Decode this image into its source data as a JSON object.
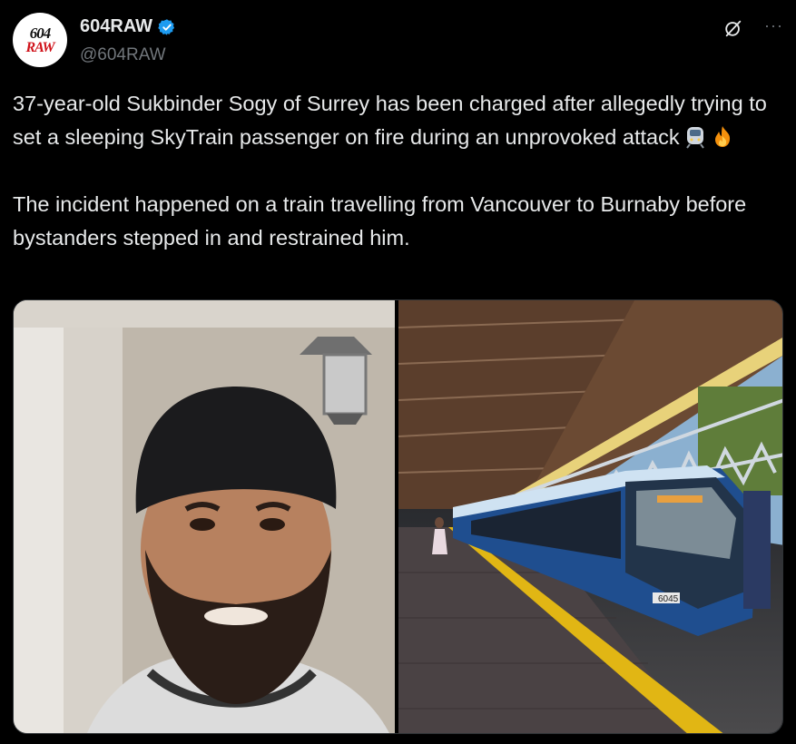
{
  "header": {
    "avatar": {
      "line1": "604",
      "line2": "RAW"
    },
    "display_name": "604RAW",
    "handle": "@604RAW",
    "verified": true,
    "icons": [
      "verified-badge-icon",
      "grok-icon",
      "more-icon"
    ],
    "more_label": "···"
  },
  "tweet": {
    "para1": "37-year-old Sukbinder Sogy of Surrey has been charged after allegedly trying to set a sleeping SkyTrain passenger on fire during an unprovoked attack",
    "para1_emojis": [
      "train-emoji",
      "fire-emoji"
    ],
    "para2": "The incident happened on a train travelling from Vancouver to Burnaby before bystanders stepped in and restrained him."
  },
  "media": {
    "photos": [
      {
        "subject": "man-portrait-photo"
      },
      {
        "subject": "skytrain-platform-photo",
        "train_number": "6045"
      }
    ]
  },
  "colors": {
    "background": "#000000",
    "text": "#e7e9ea",
    "secondary": "#71767b",
    "verified": "#1d9bf0"
  }
}
